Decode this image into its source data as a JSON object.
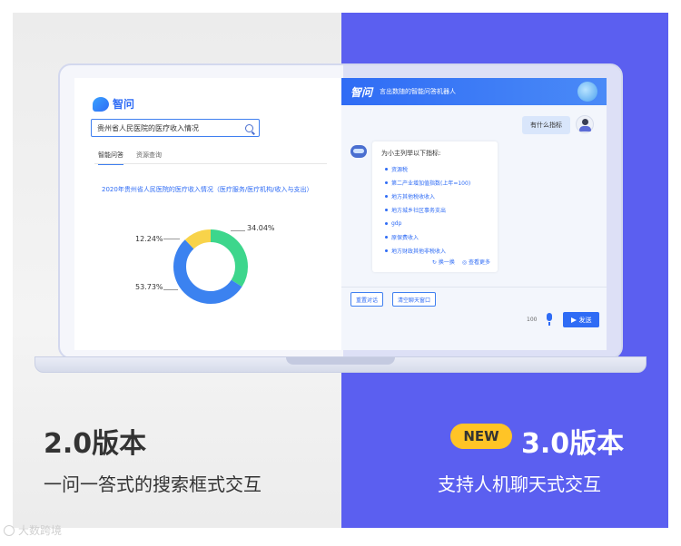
{
  "left_panel": {
    "logo_text": "智问",
    "search_value": "贵州省人民医院的医疗收入情况",
    "tabs": [
      {
        "label": "智能问答",
        "active": true
      },
      {
        "label": "资源查询",
        "active": false
      }
    ],
    "chart_title": "2020年贵州省人民医院的医疗收入情况（医疗服务/医疗机构/收入与支出）",
    "version": "2.0版本",
    "subtitle": "一问一答式的搜索框式交互"
  },
  "chart_data": {
    "type": "pie",
    "categories": [
      "",
      "",
      ""
    ],
    "values": [
      34.04,
      53.73,
      12.24
    ],
    "labels": [
      "34.04%",
      "53.73%",
      "12.24%"
    ],
    "colors": [
      "#3dd68c",
      "#3b82f0",
      "#f8d34a"
    ],
    "donut": true
  },
  "right_panel": {
    "brand": "智问",
    "slogan": "言出数随的智能问答机器人",
    "user_message": "有什么指标",
    "bot_intro": "为小主列举以下指标:",
    "bot_items": [
      "资源税",
      "第二产业增加值指数(上年=100)",
      "地方其他税收收入",
      "地方城乡社区事务支出",
      "gdp",
      "原保费收入",
      "地方财政其他非税收入"
    ],
    "refresh_label": "换一换",
    "more_label": "查看更多",
    "chip_restart": "重置对话",
    "chip_clear": "清空聊天窗口",
    "char_count": "100",
    "send_label": "发送",
    "new_badge": "NEW",
    "version": "3.0版本",
    "subtitle": "支持人机聊天式交互"
  },
  "watermark": "大数跨境",
  "colors": {
    "accent": "#2f6cf5",
    "right_bg": "#5b5ff0",
    "badge": "#ffc426"
  }
}
